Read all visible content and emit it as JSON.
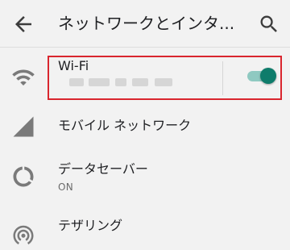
{
  "appbar": {
    "title": "ネットワークとインタ...",
    "back_icon": "arrow-back-icon",
    "search_icon": "search-icon"
  },
  "wifi": {
    "label": "Wi-Fi",
    "ssid_masked": true,
    "toggle_on": true,
    "icon": "wifi-icon"
  },
  "items": [
    {
      "label": "モバイル ネットワーク",
      "icon": "cellular-signal-icon"
    },
    {
      "label": "データセーバー",
      "summary": "ON",
      "icon": "data-saver-icon"
    },
    {
      "label": "テザリング",
      "icon": "hotspot-icon"
    }
  ],
  "colors": {
    "accent": "#0e7c6b",
    "highlight_border": "#d9262e",
    "background": "#f2f2f2"
  }
}
